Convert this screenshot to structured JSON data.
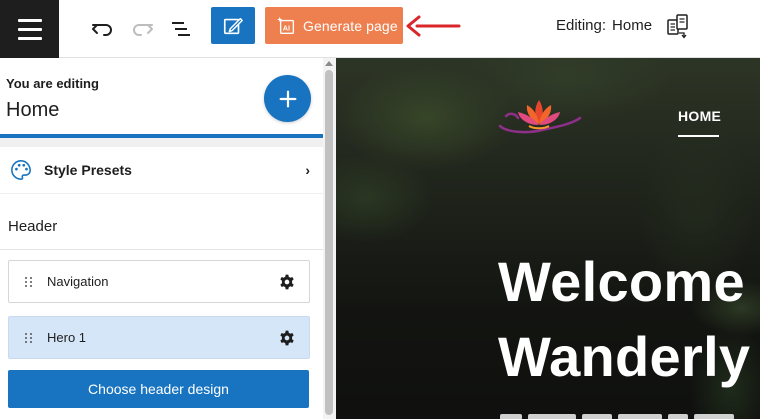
{
  "toolbar": {
    "generate_label": "Generate page",
    "editing_label": "Editing:",
    "editing_page": "Home",
    "accent_color": "#1874c0",
    "generate_color": "#ee7f4f",
    "arrow_color": "#d9262b"
  },
  "sidebar": {
    "you_are_editing": "You are editing",
    "page_name": "Home",
    "style_presets_label": "Style Presets",
    "header_title": "Header",
    "rows": [
      {
        "label": "Navigation",
        "active": false
      },
      {
        "label": "Hero 1",
        "active": true
      }
    ],
    "choose_header_label": "Choose header design"
  },
  "preview": {
    "nav_home": "HOME",
    "hero_line1": "Welcome",
    "hero_line2": "Wanderly"
  },
  "icons": [
    "menu-icon",
    "undo-icon",
    "redo-icon",
    "list-view-icon",
    "edit-design-icon",
    "ai-icon",
    "arrow-icon",
    "switch-page-icon",
    "plus-icon",
    "palette-icon",
    "chevron-right-icon",
    "drag-handle-icon",
    "gear-icon",
    "lotus-logo"
  ]
}
